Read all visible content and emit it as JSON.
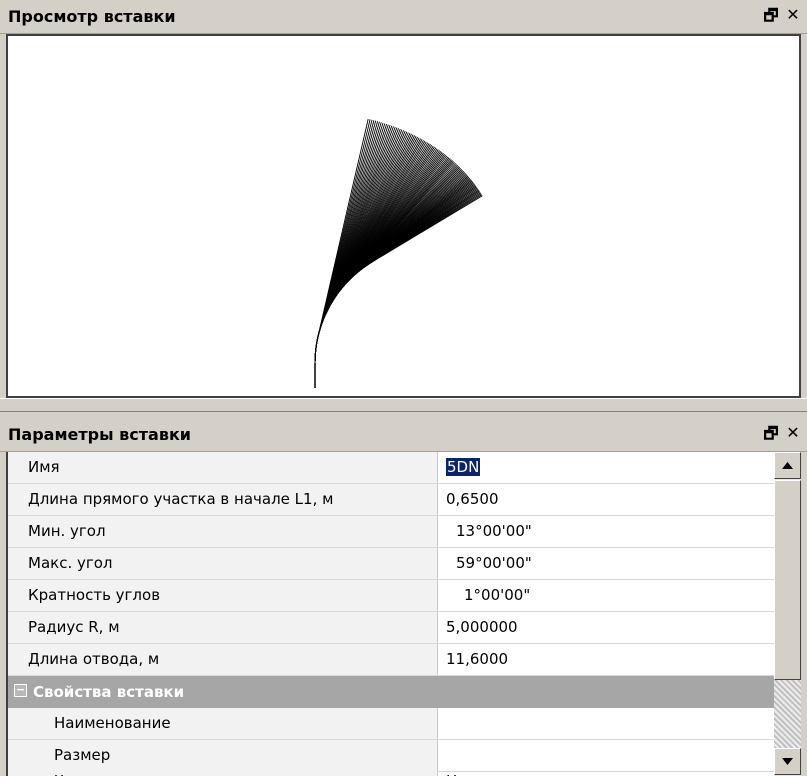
{
  "preview_panel": {
    "title": "Просмотр вставки"
  },
  "params_panel": {
    "title": "Параметры вставки",
    "rows": [
      {
        "name": "Имя",
        "value": "5DN"
      },
      {
        "name": "Длина прямого участка в начале L1, м",
        "value": "0,6500"
      },
      {
        "name": "Мин. угол",
        "value": "13°00'00\""
      },
      {
        "name": "Макс. угол",
        "value": "59°00'00\""
      },
      {
        "name": "Кратность углов",
        "value": "1°00'00\""
      },
      {
        "name": "Радиус R, м",
        "value": "5,000000"
      },
      {
        "name": "Длина отвода, м",
        "value": "11,6000"
      }
    ],
    "category": {
      "label": "Свойства вставки"
    },
    "sub_rows": [
      {
        "name": "Наименование",
        "value": ""
      },
      {
        "name": "Размер",
        "value": ""
      },
      {
        "name": "Число прокладок",
        "value": "Не определено"
      }
    ]
  },
  "icons": {
    "restore": "restore-icon",
    "close": "close-icon",
    "scroll_up": "arrow-up-icon",
    "scroll_down": "arrow-down-icon",
    "collapse": "minus-icon"
  }
}
